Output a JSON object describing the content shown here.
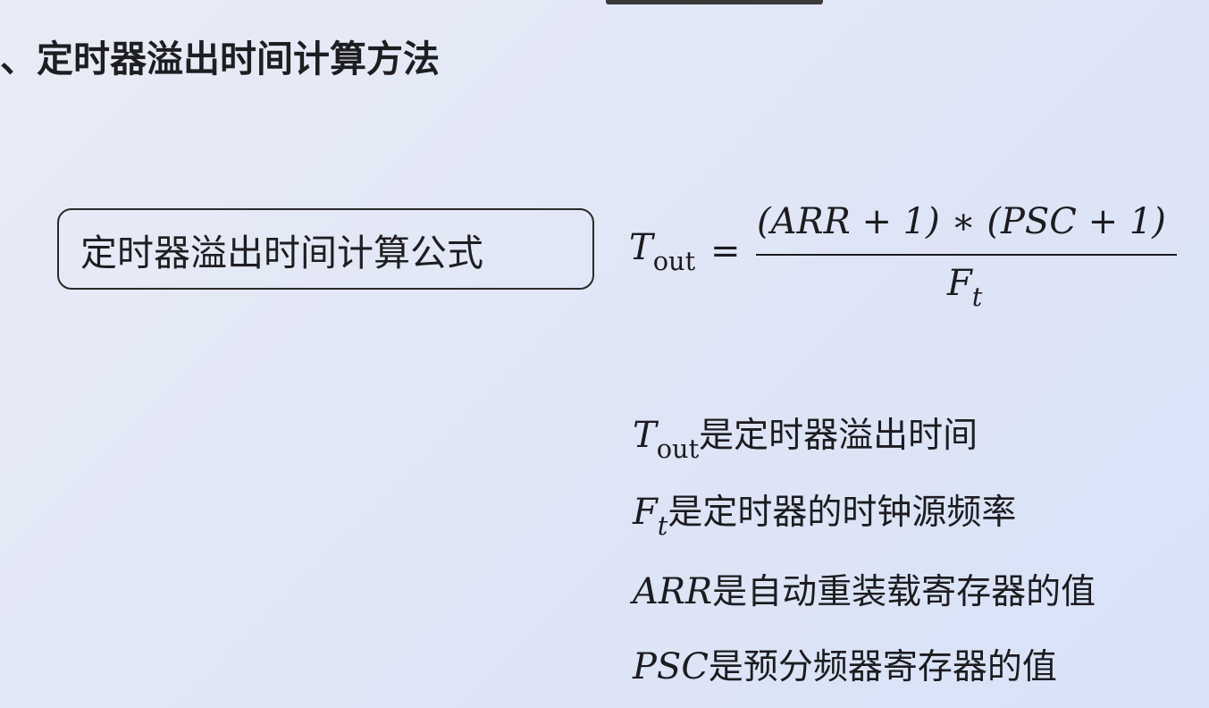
{
  "slide": {
    "title": "、定时器溢出时间计算方法"
  },
  "formula_box": {
    "label": "定时器溢出时间计算公式"
  },
  "formula": {
    "lhs_symbol": "T",
    "lhs_subscript": "out",
    "equals": "=",
    "numerator": "(ARR + 1) ∗ (PSC + 1)",
    "denominator_symbol": "F",
    "denominator_subscript": "t"
  },
  "definitions": [
    {
      "symbol": "T",
      "subscript": "out",
      "text": "是定时器溢出时间"
    },
    {
      "symbol": "F",
      "subscript": "t",
      "text": "是定时器的时钟源频率"
    },
    {
      "symbol": "ARR",
      "subscript": "",
      "text": "是自动重装载寄存器的值"
    },
    {
      "symbol": "PSC",
      "subscript": "",
      "text": "是预分频器寄存器的值"
    }
  ]
}
